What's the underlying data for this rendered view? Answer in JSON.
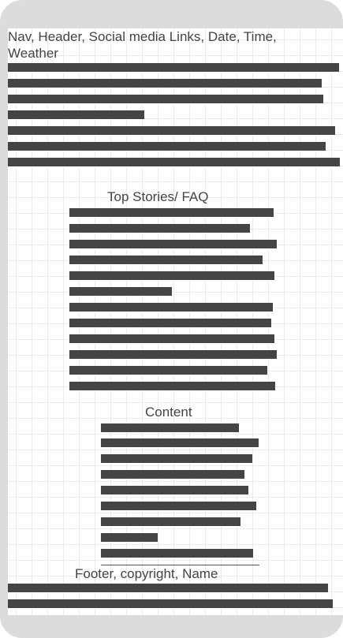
{
  "sections": {
    "header": {
      "title": "Nav, Header, Social media Links, Date, Time, Weather"
    },
    "top_stories": {
      "title": "Top Stories/ FAQ"
    },
    "content": {
      "title": "Content"
    },
    "footer": {
      "title": "Footer, copyright, Name"
    }
  },
  "colors": {
    "frame": "#dcdcdc",
    "bar": "#444444",
    "grid": "#ececec",
    "text": "#444444"
  }
}
